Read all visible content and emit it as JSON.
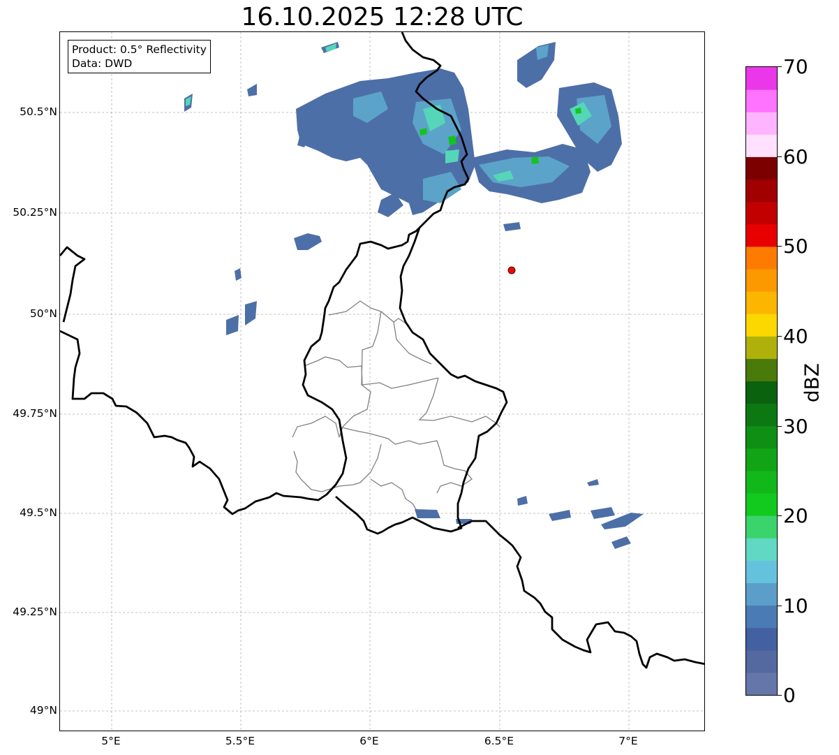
{
  "title": "16.10.2025 12:28 UTC",
  "info_box": {
    "product": "Product: 0.5° Reflectivity",
    "data_source": "Data: DWD"
  },
  "axes": {
    "lon_ticks": [
      "5°E",
      "5.5°E",
      "6°E",
      "6.5°E",
      "7°E"
    ],
    "lat_ticks": [
      "50.5°N",
      "50.25°N",
      "50°N",
      "49.75°N",
      "49.5°N",
      "49.25°N",
      "49°N"
    ],
    "lon_range": [
      4.8,
      7.3
    ],
    "lat_range": [
      48.95,
      50.7
    ],
    "grid": true
  },
  "radar_site": {
    "lon": 6.55,
    "lat": 50.11,
    "marker_color": "#ff0000"
  },
  "colorbar": {
    "label": "dBZ",
    "ticks": [
      "0",
      "10",
      "20",
      "30",
      "40",
      "50",
      "60",
      "70"
    ],
    "min": 0,
    "max": 70,
    "step": 2.5,
    "colors": [
      "#6577a8",
      "#53699f",
      "#4360a2",
      "#4b7bb4",
      "#5a9ec9",
      "#65c2dd",
      "#60d8c4",
      "#3bd46c",
      "#12c91e",
      "#12b81a",
      "#11a516",
      "#0f8f14",
      "#0c7811",
      "#0a610e",
      "#4a7a0a",
      "#afb10a",
      "#fcd700",
      "#fcb600",
      "#fc9900",
      "#fc7b00",
      "#e80000",
      "#c20000",
      "#a00000",
      "#7b0000",
      "#ffe0ff",
      "#ffb4ff",
      "#ff73ff",
      "#ea37ea"
    ]
  }
}
